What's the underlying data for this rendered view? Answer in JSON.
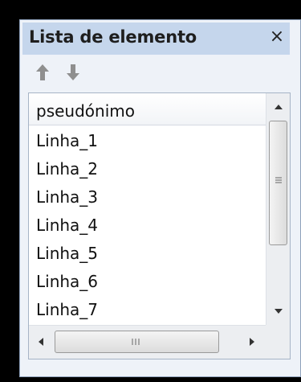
{
  "panel": {
    "title": "Lista de elemento",
    "close_glyph": "×",
    "toolbar": {
      "move_up_icon": "arrow-up-icon",
      "move_down_icon": "arrow-down-icon"
    },
    "list": {
      "column_header": "pseudónimo",
      "items": [
        "Linha_1",
        "Linha_2",
        "Linha_3",
        "Linha_4",
        "Linha_5",
        "Linha_6",
        "Linha_7"
      ]
    }
  },
  "colors": {
    "titlebar_bg": "#c5d6ec",
    "panel_bg": "#eef2f8",
    "toolbar_icon": "#8a8a8a"
  }
}
